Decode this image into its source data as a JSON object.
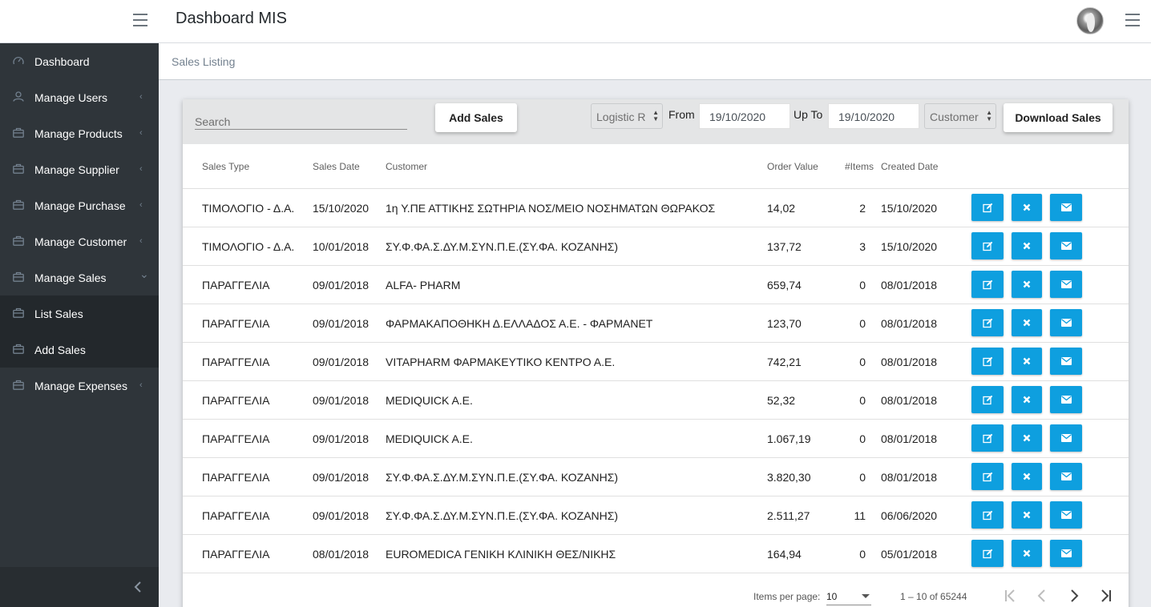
{
  "header": {
    "title": "Dashboard MIS"
  },
  "sidebar": {
    "items": [
      {
        "label": "Dashboard",
        "icon": "speedometer-icon",
        "has_caret": false
      },
      {
        "label": "Manage Users",
        "icon": "user-icon",
        "has_caret": true
      },
      {
        "label": "Manage Products",
        "icon": "briefcase-icon",
        "has_caret": true
      },
      {
        "label": "Manage Supplier",
        "icon": "briefcase-icon",
        "has_caret": true
      },
      {
        "label": "Manage Purchase",
        "icon": "briefcase-icon",
        "has_caret": true
      },
      {
        "label": "Manage Customer",
        "icon": "briefcase-icon",
        "has_caret": true
      },
      {
        "label": "Manage Sales",
        "icon": "briefcase-icon",
        "has_caret": true,
        "open": true
      },
      {
        "label": "List Sales",
        "icon": "briefcase-icon",
        "sub": true
      },
      {
        "label": "Add Sales",
        "icon": "briefcase-icon",
        "sub": true
      },
      {
        "label": "Manage Expenses",
        "icon": "briefcase-icon",
        "has_caret": true
      }
    ]
  },
  "breadcrumb": {
    "current": "Sales Listing"
  },
  "toolbar": {
    "search_placeholder": "Search",
    "add_label": "Add Sales",
    "logistic_value": "Logistic R",
    "from_label": "From",
    "from_value": "19/10/2020",
    "to_label": "Up To",
    "to_value": "19/10/2020",
    "customer_value": "Customer",
    "download_label": "Download Sales"
  },
  "table": {
    "headers": {
      "type": "Sales Type",
      "date": "Sales Date",
      "customer": "Customer",
      "value": "Order Value",
      "items": "#Items",
      "created": "Created Date"
    },
    "rows": [
      {
        "type": "ΤΙΜΟΛΟΓΙΟ - Δ.Α.",
        "date": "15/10/2020",
        "customer": "1η Υ.ΠΕ ΑΤΤΙΚΗΣ ΣΩΤΗΡΙΑ ΝΟΣ/ΜΕΙΟ ΝΟΣΗΜΑΤΩΝ ΘΩΡΑΚΟΣ",
        "value": "14,02",
        "items": "2",
        "created": "15/10/2020"
      },
      {
        "type": "ΤΙΜΟΛΟΓΙΟ - Δ.Α.",
        "date": "10/01/2018",
        "customer": "ΣΥ.Φ.ΦΑ.Σ.ΔΥ.Μ.ΣΥΝ.Π.Ε.(ΣΥ.ΦΑ. ΚΟΖΑΝΗΣ)",
        "value": "137,72",
        "items": "3",
        "created": "15/10/2020"
      },
      {
        "type": "ΠΑΡΑΓΓΕΛΙΑ",
        "date": "09/01/2018",
        "customer": "ALFA- PHARM",
        "value": "659,74",
        "items": "0",
        "created": "08/01/2018"
      },
      {
        "type": "ΠΑΡΑΓΓΕΛΙΑ",
        "date": "09/01/2018",
        "customer": "ΦΑΡΜΑΚΑΠΟΘΗΚΗ Δ.ΕΛΛΑΔΟΣ Α.Ε. - ΦΑΡΜΑΝΕΤ",
        "value": "123,70",
        "items": "0",
        "created": "08/01/2018"
      },
      {
        "type": "ΠΑΡΑΓΓΕΛΙΑ",
        "date": "09/01/2018",
        "customer": "VITAPHARM ΦΑΡΜΑΚΕΥΤΙΚΟ ΚΕΝΤΡΟ Α.Ε.",
        "value": "742,21",
        "items": "0",
        "created": "08/01/2018"
      },
      {
        "type": "ΠΑΡΑΓΓΕΛΙΑ",
        "date": "09/01/2018",
        "customer": "MEDIQUICK A.E.",
        "value": "52,32",
        "items": "0",
        "created": "08/01/2018"
      },
      {
        "type": "ΠΑΡΑΓΓΕΛΙΑ",
        "date": "09/01/2018",
        "customer": "MEDIQUICK A.E.",
        "value": "1.067,19",
        "items": "0",
        "created": "08/01/2018"
      },
      {
        "type": "ΠΑΡΑΓΓΕΛΙΑ",
        "date": "09/01/2018",
        "customer": "ΣΥ.Φ.ΦΑ.Σ.ΔΥ.Μ.ΣΥΝ.Π.Ε.(ΣΥ.ΦΑ. ΚΟΖΑΝΗΣ)",
        "value": "3.820,30",
        "items": "0",
        "created": "08/01/2018"
      },
      {
        "type": "ΠΑΡΑΓΓΕΛΙΑ",
        "date": "09/01/2018",
        "customer": "ΣΥ.Φ.ΦΑ.Σ.ΔΥ.Μ.ΣΥΝ.Π.Ε.(ΣΥ.ΦΑ. ΚΟΖΑΝΗΣ)",
        "value": "2.511,27",
        "items": "11",
        "created": "06/06/2020"
      },
      {
        "type": "ΠΑΡΑΓΓΕΛΙΑ",
        "date": "08/01/2018",
        "customer": "EUROMEDICA ΓΕΝΙΚΗ ΚΛΙΝΙΚΗ ΘΕΣ/ΝΙΚΗΣ",
        "value": "164,94",
        "items": "0",
        "created": "05/01/2018"
      }
    ]
  },
  "paginator": {
    "items_per_page_label": "Items per page:",
    "page_size": "10",
    "range_label": "1 – 10 of 65244"
  },
  "colors": {
    "sidebar_bg": "#2f353a",
    "sidebar_active_bg": "#23282c",
    "action_button": "#0e9fdf",
    "toolbar_bg": "#e4e5e6"
  }
}
